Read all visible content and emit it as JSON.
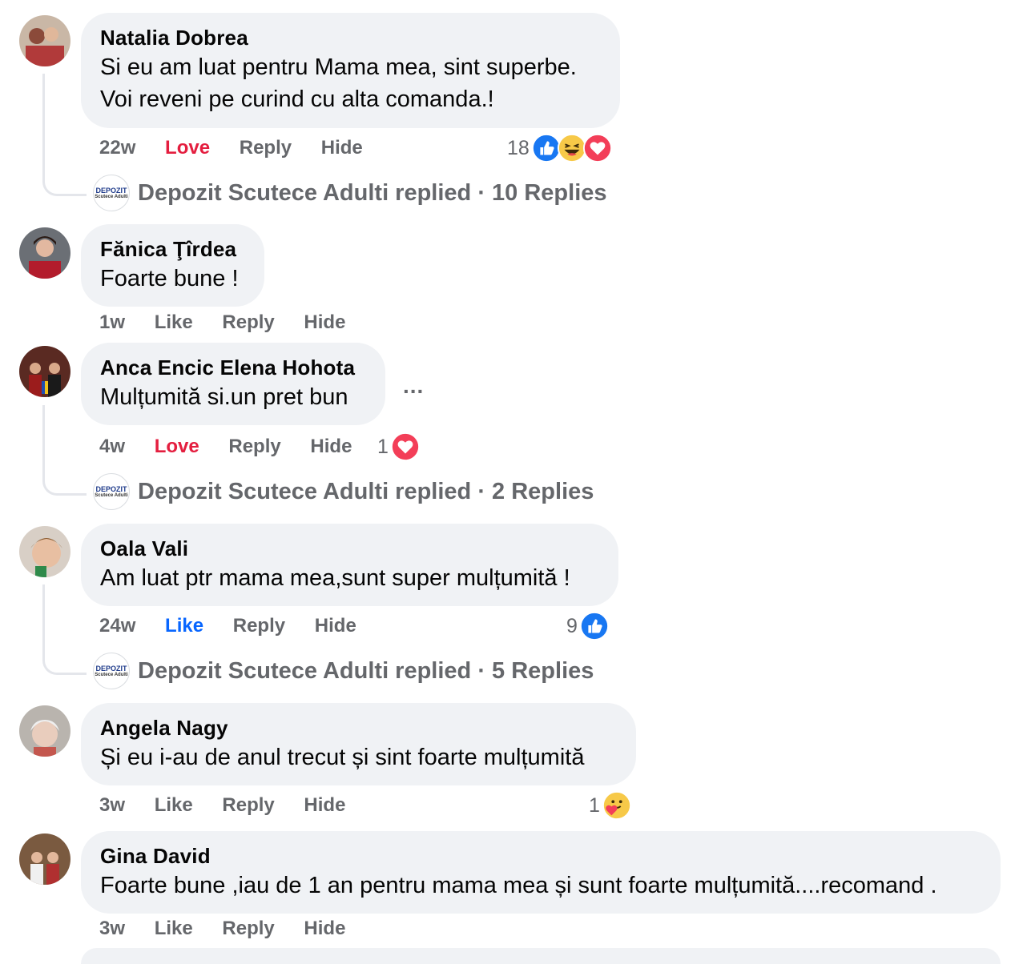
{
  "comments": [
    {
      "name": "Natalia Dobrea",
      "text1": "Si eu am luat pentru Mama mea, sint superbe.",
      "text2": "Voi reveni pe curind cu alta comanda.!",
      "time": "22w",
      "like": "Love",
      "reply": "Reply",
      "hide": "Hide",
      "reaction_count": "18"
    },
    {
      "name": "Fănica Ţîrdea",
      "text1": "Foarte bune !",
      "time": "1w",
      "like": "Like",
      "reply": "Reply",
      "hide": "Hide"
    },
    {
      "name": "Anca Encic Elena Hohota",
      "text1": "Mulțumită si.un pret bun",
      "time": "4w",
      "like": "Love",
      "reply": "Reply",
      "hide": "Hide",
      "reaction_count": "1",
      "more": "..."
    },
    {
      "name": "Oala Vali",
      "text1": "Am luat ptr mama mea,sunt super mulțumită !",
      "time": "24w",
      "like": "Like",
      "reply": "Reply",
      "hide": "Hide",
      "reaction_count": "9"
    },
    {
      "name": "Angela Nagy",
      "text1": "Și eu i-au de anul trecut și sint foarte mulțumită",
      "time": "3w",
      "like": "Like",
      "reply": "Reply",
      "hide": "Hide",
      "reaction_count": "1"
    },
    {
      "name": "Gina David",
      "text1": "Foarte bune ,iau de 1 an pentru mama mea și sunt foarte mulțumită....recomand .",
      "time": "3w",
      "like": "Like",
      "reply": "Reply",
      "hide": "Hide"
    }
  ],
  "replies": [
    {
      "text": "Depozit Scutece Adulti replied · 10 Replies"
    },
    {
      "text": "Depozit Scutece Adulti replied · 2 Replies"
    },
    {
      "text": "Depozit Scutece Adulti replied · 5 Replies"
    }
  ],
  "page_logo": {
    "line1": "DEPOZIT",
    "line2": "Scutece Adulti"
  },
  "icons": [
    "like-icon",
    "haha-icon",
    "love-icon",
    "care-icon",
    "more-icon"
  ],
  "colors": {
    "love": "#e41e3f",
    "like_active": "#0866ff",
    "bubble": "#f0f2f5",
    "muted": "#65676b"
  }
}
